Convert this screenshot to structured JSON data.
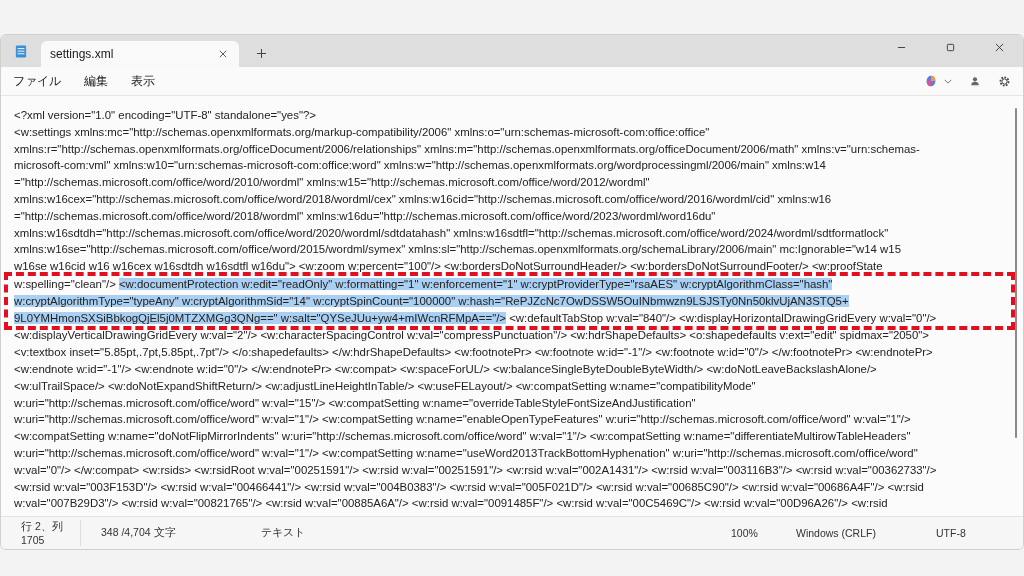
{
  "window": {
    "tab_title": "settings.xml",
    "menu": [
      "ファイル",
      "編集",
      "表示"
    ]
  },
  "editor": {
    "lines": [
      {
        "boxed": false,
        "segments": [
          {
            "text": "<?xml version=\"1.0\" encoding=\"UTF-8\" standalone=\"yes\"?>",
            "selected": false
          }
        ]
      },
      {
        "boxed": false,
        "segments": [
          {
            "text": "<w:settings xmlns:mc=\"http://schemas.openxmlformats.org/markup-compatibility/2006\" xmlns:o=\"urn:schemas-microsoft-com:office:office\"",
            "selected": false
          }
        ]
      },
      {
        "boxed": false,
        "segments": [
          {
            "text": "xmlns:r=\"http://schemas.openxmlformats.org/officeDocument/2006/relationships\" xmlns:m=\"http://schemas.openxmlformats.org/officeDocument/2006/math\" xmlns:v=\"urn:schemas-",
            "selected": false
          }
        ]
      },
      {
        "boxed": false,
        "segments": [
          {
            "text": "microsoft-com:vml\" xmlns:w10=\"urn:schemas-microsoft-com:office:word\" xmlns:w=\"http://schemas.openxmlformats.org/wordprocessingml/2006/main\" xmlns:w14",
            "selected": false
          }
        ]
      },
      {
        "boxed": false,
        "segments": [
          {
            "text": "=\"http://schemas.microsoft.com/office/word/2010/wordml\" xmlns:w15=\"http://schemas.microsoft.com/office/word/2012/wordml\"",
            "selected": false
          }
        ]
      },
      {
        "boxed": false,
        "segments": [
          {
            "text": "xmlns:w16cex=\"http://schemas.microsoft.com/office/word/2018/wordml/cex\" xmlns:w16cid=\"http://schemas.microsoft.com/office/word/2016/wordml/cid\" xmlns:w16",
            "selected": false
          }
        ]
      },
      {
        "boxed": false,
        "segments": [
          {
            "text": "=\"http://schemas.microsoft.com/office/word/2018/wordml\" xmlns:w16du=\"http://schemas.microsoft.com/office/word/2023/wordml/word16du\"",
            "selected": false
          }
        ]
      },
      {
        "boxed": false,
        "segments": [
          {
            "text": "xmlns:w16sdtdh=\"http://schemas.microsoft.com/office/word/2020/wordml/sdtdatahash\" xmlns:w16sdtfl=\"http://schemas.microsoft.com/office/word/2024/wordml/sdtformatlock\"",
            "selected": false
          }
        ]
      },
      {
        "boxed": false,
        "segments": [
          {
            "text": "xmlns:w16se=\"http://schemas.microsoft.com/office/word/2015/wordml/symex\" xmlns:sl=\"http://schemas.openxmlformats.org/schemaLibrary/2006/main\" mc:Ignorable=\"w14 w15",
            "selected": false
          }
        ]
      },
      {
        "boxed": false,
        "segments": [
          {
            "text": "w16se w16cid w16 w16cex w16sdtdh w16sdtfl w16du\"> <w:zoom w:percent=\"100\"/> <w:bordersDoNotSurroundHeader/> <w:bordersDoNotSurroundFooter/> <w:proofState",
            "selected": false
          }
        ]
      },
      {
        "boxed": true,
        "segments": [
          {
            "text": "w:spelling=\"clean\"/> ",
            "selected": false
          },
          {
            "text": "<w:documentProtection w:edit=\"readOnly\" w:formatting=\"1\" w:enforcement=\"1\" w:cryptProviderType=\"rsaAES\" w:cryptAlgorithmClass=\"hash\"",
            "selected": true
          }
        ]
      },
      {
        "boxed": true,
        "segments": [
          {
            "text": "w:cryptAlgorithmType=\"typeAny\" w:cryptAlgorithmSid=\"14\" w:cryptSpinCount=\"100000\" w:hash=\"RePJZcNc7OwDSSW5OuINbmwzn9LSJSTy0Nn50klvUjAN3STQ5+",
            "selected": true
          }
        ]
      },
      {
        "boxed": true,
        "segments": [
          {
            "text": "9L0YMHmonSXSiBbkogQjEl5j0MTZXMGg3QNg==\" w:salt=\"QYSeJUu+yw4+mIWcnRFMpA==\"/>",
            "selected": true
          },
          {
            "text": " <w:defaultTabStop w:val=\"840\"/> <w:displayHorizontalDrawingGridEvery w:val=\"0\"/>",
            "selected": false
          }
        ]
      },
      {
        "boxed": false,
        "segments": [
          {
            "text": "<w:displayVerticalDrawingGridEvery w:val=\"2\"/> <w:characterSpacingControl w:val=\"compressPunctuation\"/> <w:hdrShapeDefaults> <o:shapedefaults v:ext=\"edit\" spidmax=\"2050\">",
            "selected": false
          }
        ]
      },
      {
        "boxed": false,
        "segments": [
          {
            "text": "<v:textbox inset=\"5.85pt,.7pt,5.85pt,.7pt\"/> </o:shapedefaults> </w:hdrShapeDefaults> <w:footnotePr> <w:footnote w:id=\"-1\"/> <w:footnote w:id=\"0\"/> </w:footnotePr> <w:endnotePr>",
            "selected": false
          }
        ]
      },
      {
        "boxed": false,
        "segments": [
          {
            "text": "<w:endnote w:id=\"-1\"/> <w:endnote w:id=\"0\"/> </w:endnotePr> <w:compat> <w:spaceForUL/> <w:balanceSingleByteDoubleByteWidth/> <w:doNotLeaveBackslashAlone/>",
            "selected": false
          }
        ]
      },
      {
        "boxed": false,
        "segments": [
          {
            "text": "<w:ulTrailSpace/> <w:doNotExpandShiftReturn/> <w:adjustLineHeightInTable/> <w:useFELayout/> <w:compatSetting w:name=\"compatibilityMode\"",
            "selected": false
          }
        ]
      },
      {
        "boxed": false,
        "segments": [
          {
            "text": "w:uri=\"http://schemas.microsoft.com/office/word\" w:val=\"15\"/> <w:compatSetting w:name=\"overrideTableStyleFontSizeAndJustification\"",
            "selected": false
          }
        ]
      },
      {
        "boxed": false,
        "segments": [
          {
            "text": "w:uri=\"http://schemas.microsoft.com/office/word\" w:val=\"1\"/> <w:compatSetting w:name=\"enableOpenTypeFeatures\" w:uri=\"http://schemas.microsoft.com/office/word\" w:val=\"1\"/>",
            "selected": false
          }
        ]
      },
      {
        "boxed": false,
        "segments": [
          {
            "text": "<w:compatSetting w:name=\"doNotFlipMirrorIndents\" w:uri=\"http://schemas.microsoft.com/office/word\" w:val=\"1\"/> <w:compatSetting w:name=\"differentiateMultirowTableHeaders\"",
            "selected": false
          }
        ]
      },
      {
        "boxed": false,
        "segments": [
          {
            "text": "w:uri=\"http://schemas.microsoft.com/office/word\" w:val=\"1\"/> <w:compatSetting w:name=\"useWord2013TrackBottomHyphenation\" w:uri=\"http://schemas.microsoft.com/office/word\"",
            "selected": false
          }
        ]
      },
      {
        "boxed": false,
        "segments": [
          {
            "text": "w:val=\"0\"/> </w:compat> <w:rsids> <w:rsidRoot w:val=\"00251591\"/> <w:rsid w:val=\"00251591\"/> <w:rsid w:val=\"002A1431\"/> <w:rsid w:val=\"003116B3\"/> <w:rsid w:val=\"00362733\"/>",
            "selected": false
          }
        ]
      },
      {
        "boxed": false,
        "segments": [
          {
            "text": "<w:rsid w:val=\"003F153D\"/> <w:rsid w:val=\"00466441\"/> <w:rsid w:val=\"004B0383\"/> <w:rsid w:val=\"005F021D\"/> <w:rsid w:val=\"00685C90\"/> <w:rsid w:val=\"00686A4F\"/> <w:rsid",
            "selected": false
          }
        ]
      },
      {
        "boxed": false,
        "segments": [
          {
            "text": "w:val=\"007B29D3\"/> <w:rsid w:val=\"00821765\"/> <w:rsid w:val=\"00885A6A\"/> <w:rsid w:val=\"0091485F\"/> <w:rsid w:val=\"00C5469C\"/> <w:rsid w:val=\"00D96A26\"/> <w:rsid",
            "selected": false
          }
        ]
      }
    ]
  },
  "status_bar": {
    "position": "行 2、列 1705",
    "count": "348 /4,704 文字",
    "format": "テキスト",
    "zoom": "100%",
    "line_ending": "Windows (CRLF)",
    "encoding": "UTF-8"
  }
}
